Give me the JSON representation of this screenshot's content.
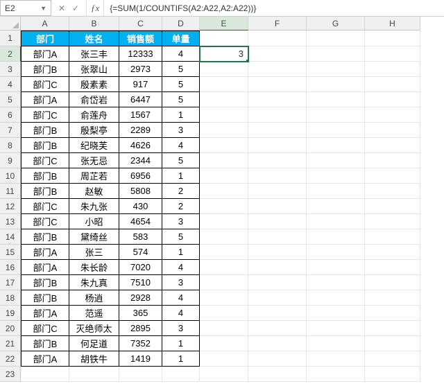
{
  "name_box": "E2",
  "formula": "{=SUM(1/COUNTIFS(A2:A22,A2:A22))}",
  "columns": [
    "A",
    "B",
    "C",
    "D",
    "E",
    "F",
    "G",
    "H"
  ],
  "active_col": "E",
  "active_row": 2,
  "visible_rows": 23,
  "headers": {
    "dept": "部门",
    "name": "姓名",
    "sales": "销售额",
    "qty": "单量"
  },
  "e2_value": "3",
  "rows": [
    {
      "dept": "部门A",
      "name": "张三丰",
      "sales": "12333",
      "qty": "4"
    },
    {
      "dept": "部门B",
      "name": "张翠山",
      "sales": "2973",
      "qty": "5"
    },
    {
      "dept": "部门C",
      "name": "殷素素",
      "sales": "917",
      "qty": "5"
    },
    {
      "dept": "部门A",
      "name": "俞岱岩",
      "sales": "6447",
      "qty": "5"
    },
    {
      "dept": "部门C",
      "name": "俞莲舟",
      "sales": "1567",
      "qty": "1"
    },
    {
      "dept": "部门B",
      "name": "殷梨亭",
      "sales": "2289",
      "qty": "3"
    },
    {
      "dept": "部门B",
      "name": "纪晓芙",
      "sales": "4626",
      "qty": "4"
    },
    {
      "dept": "部门C",
      "name": "张无忌",
      "sales": "2344",
      "qty": "5"
    },
    {
      "dept": "部门B",
      "name": "周芷若",
      "sales": "6956",
      "qty": "1"
    },
    {
      "dept": "部门B",
      "name": "赵敏",
      "sales": "5808",
      "qty": "2"
    },
    {
      "dept": "部门C",
      "name": "朱九张",
      "sales": "430",
      "qty": "2"
    },
    {
      "dept": "部门C",
      "name": "小昭",
      "sales": "4654",
      "qty": "3"
    },
    {
      "dept": "部门B",
      "name": "黛绮丝",
      "sales": "583",
      "qty": "5"
    },
    {
      "dept": "部门A",
      "name": "张三",
      "sales": "574",
      "qty": "1"
    },
    {
      "dept": "部门A",
      "name": "朱长龄",
      "sales": "7020",
      "qty": "4"
    },
    {
      "dept": "部门B",
      "name": "朱九真",
      "sales": "7510",
      "qty": "3"
    },
    {
      "dept": "部门B",
      "name": "杨逍",
      "sales": "2928",
      "qty": "4"
    },
    {
      "dept": "部门A",
      "name": "范遥",
      "sales": "365",
      "qty": "4"
    },
    {
      "dept": "部门C",
      "name": "灭绝师太",
      "sales": "2895",
      "qty": "3"
    },
    {
      "dept": "部门B",
      "name": "何足道",
      "sales": "7352",
      "qty": "1"
    },
    {
      "dept": "部门A",
      "name": "胡铁牛",
      "sales": "1419",
      "qty": "1"
    }
  ]
}
